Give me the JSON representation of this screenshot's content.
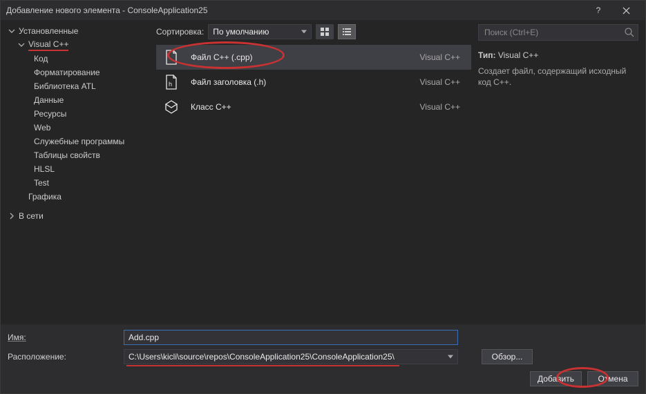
{
  "titlebar": {
    "title": "Добавление нового элемента  - ConsoleApplication25",
    "help_label": "?",
    "close_label": "✕"
  },
  "tree": {
    "roots": [
      {
        "label": "Установленные",
        "expanded": true
      },
      {
        "label": "В сети",
        "expanded": false
      }
    ],
    "visualcpp": "Visual C++",
    "children": [
      "Код",
      "Форматирование",
      "Библиотека ATL",
      "Данные",
      "Ресурсы",
      "Web",
      "Служебные программы",
      "Таблицы свойств",
      "HLSL",
      "Test"
    ],
    "graphics": "Графика"
  },
  "sort": {
    "label": "Сортировка:",
    "value": "По умолчанию"
  },
  "templates": [
    {
      "name": "Файл C++ (.cpp)",
      "lang": "Visual C++",
      "selected": true,
      "icon": "cpp"
    },
    {
      "name": "Файл заголовка (.h)",
      "lang": "Visual C++",
      "selected": false,
      "icon": "h"
    },
    {
      "name": "Класс C++",
      "lang": "Visual C++",
      "selected": false,
      "icon": "class"
    }
  ],
  "search": {
    "placeholder": "Поиск (Ctrl+E)"
  },
  "info": {
    "type_label": "Тип:",
    "type_value": "Visual C++",
    "description": "Создает файл, содержащий исходный код C++."
  },
  "form": {
    "name_label": "Имя:",
    "name_value": "Add.cpp",
    "location_label": "Расположение:",
    "location_value": "C:\\Users\\kicli\\source\\repos\\ConsoleApplication25\\ConsoleApplication25\\",
    "browse_label": "Обзор...",
    "add_label": "Добавить",
    "cancel_label": "Отмена"
  }
}
